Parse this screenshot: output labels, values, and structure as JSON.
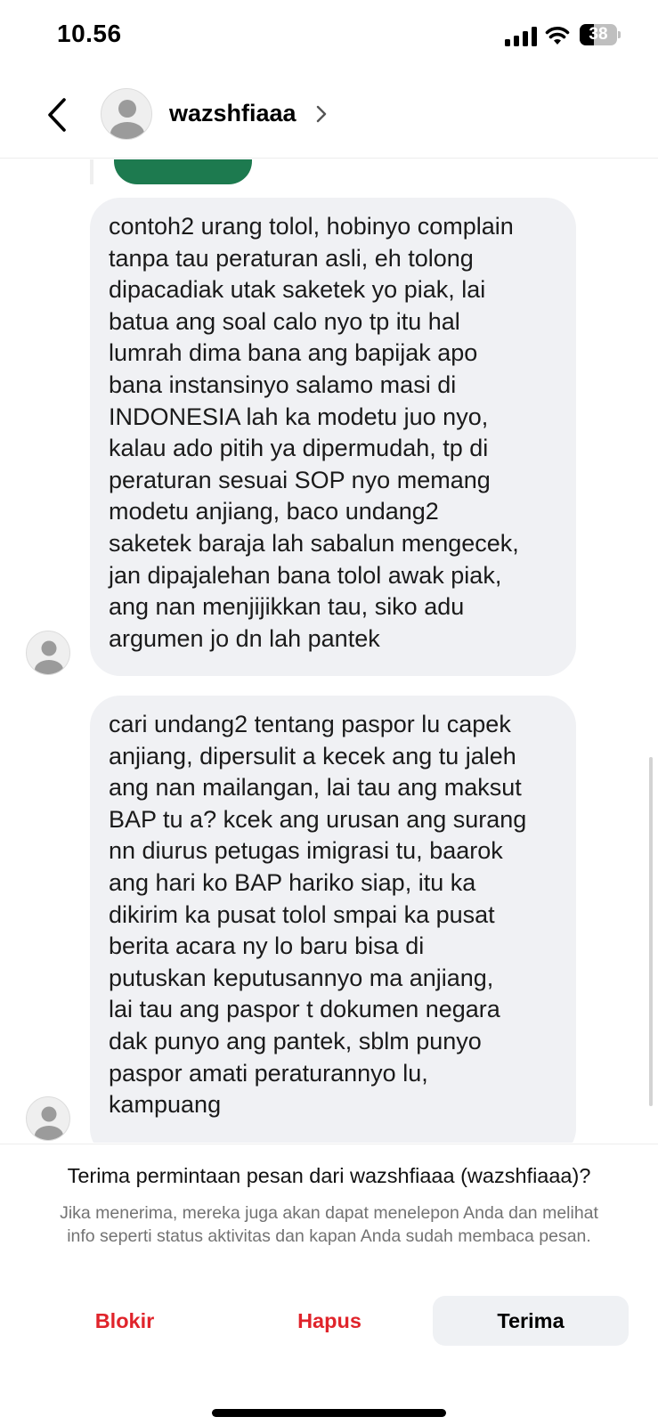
{
  "status_bar": {
    "time": "10.56",
    "battery_percent": "38",
    "battery_level": 0.38
  },
  "header": {
    "username": "wazshfiaaa"
  },
  "messages": [
    {
      "lines": [
        "contoh2 urang tolol, hobinyo complain",
        "tanpa tau peraturan asli, eh tolong",
        "dipacadiak utak saketek yo piak, lai",
        "batua ang soal calo nyo tp itu hal",
        "lumrah dima bana ang bapijak apo",
        "bana instansinyo salamo masi di",
        "INDONESIA lah ka modetu juo nyo,",
        "kalau ado pitih ya dipermudah, tp di",
        "peraturan sesuai SOP nyo memang",
        "modetu anjiang, baco undang2",
        "saketek baraja lah sabalun mengecek,",
        "jan dipajalehan bana tolol awak piak,",
        "ang nan menjijikkan tau, siko adu",
        "argumen jo dn lah pantek"
      ]
    },
    {
      "lines": [
        "cari undang2 tentang paspor lu capek",
        "anjiang, dipersulit a kecek ang tu jaleh",
        "ang nan mailangan, lai tau ang maksut",
        "BAP tu a? kcek ang urusan ang surang",
        "nn diurus petugas imigrasi tu, baarok",
        "ang hari ko BAP hariko siap, itu ka",
        "dikirim ka pusat tolol smpai ka pusat",
        "berita acara ny lo baru bisa di",
        "putuskan keputusannyo ma anjiang,",
        "lai tau ang paspor t dokumen negara",
        "dak punyo ang pantek, sblm punyo",
        "paspor amati peraturannyo lu,",
        "kampuang"
      ]
    }
  ],
  "request": {
    "title": "Terima permintaan pesan dari wazshfiaaa (wazshfiaaa)?",
    "description": "Jika menerima, mereka juga akan dapat menelepon Anda dan melihat info seperti status aktivitas dan kapan Anda sudah membaca pesan.",
    "block_label": "Blokir",
    "delete_label": "Hapus",
    "accept_label": "Terima"
  },
  "colors": {
    "bubble_bg": "#f0f1f4",
    "destructive": "#e0242b",
    "muted_text": "#737373"
  }
}
